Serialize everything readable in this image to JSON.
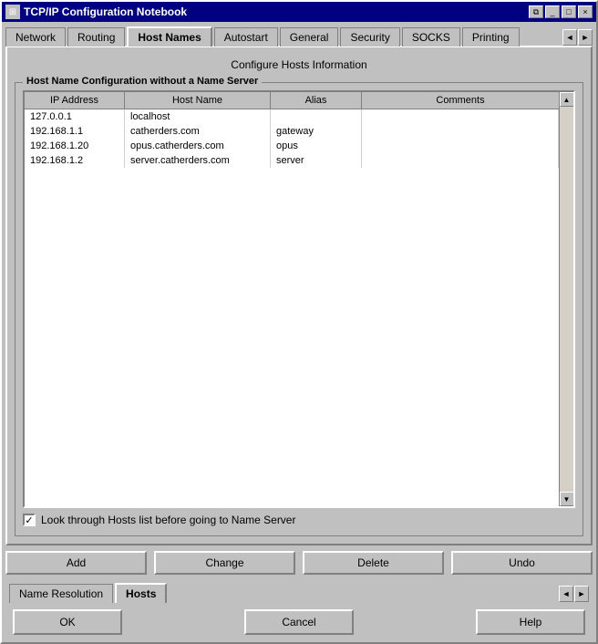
{
  "window": {
    "title": "TCP/IP Configuration Notebook",
    "title_icon": "📋"
  },
  "title_buttons": {
    "minimize": "_",
    "restore": "□",
    "close": "×",
    "copy": "⧉",
    "arrow_left": "◄",
    "arrow_right": "►"
  },
  "tabs": [
    {
      "id": "network",
      "label": "Network",
      "active": false
    },
    {
      "id": "routing",
      "label": "Routing",
      "active": false
    },
    {
      "id": "hostnames",
      "label": "Host Names",
      "active": true
    },
    {
      "id": "autostart",
      "label": "Autostart",
      "active": false
    },
    {
      "id": "general",
      "label": "General",
      "active": false
    },
    {
      "id": "security",
      "label": "Security",
      "active": false
    },
    {
      "id": "socks",
      "label": "SOCKS",
      "active": false
    },
    {
      "id": "printing",
      "label": "Printing",
      "active": false
    }
  ],
  "configure_label": "Configure Hosts Information",
  "group_box": {
    "title": "Host Name Configuration without a Name Server"
  },
  "table": {
    "headers": [
      "IP Address",
      "Host Name",
      "Alias",
      "Comments"
    ],
    "rows": [
      {
        "ip": "127.0.0.1",
        "hostname": "localhost",
        "alias": "",
        "comments": ""
      },
      {
        "ip": "192.168.1.1",
        "hostname": "catherders.com",
        "alias": "gateway",
        "comments": ""
      },
      {
        "ip": "192.168.1.20",
        "hostname": "opus.catherders.com",
        "alias": "opus",
        "comments": ""
      },
      {
        "ip": "192.168.1.2",
        "hostname": "server.catherders.com",
        "alias": "server",
        "comments": ""
      }
    ]
  },
  "checkbox": {
    "checked": true,
    "label": "Look through Hosts list before going to Name Server"
  },
  "buttons": {
    "add": "Add",
    "change": "Change",
    "delete": "Delete",
    "undo": "Undo"
  },
  "bottom_tabs": [
    {
      "id": "name-resolution",
      "label": "Name Resolution",
      "active": false
    },
    {
      "id": "hosts",
      "label": "Hosts",
      "active": true
    }
  ],
  "footer": {
    "ok": "OK",
    "cancel": "Cancel",
    "help": "Help"
  }
}
